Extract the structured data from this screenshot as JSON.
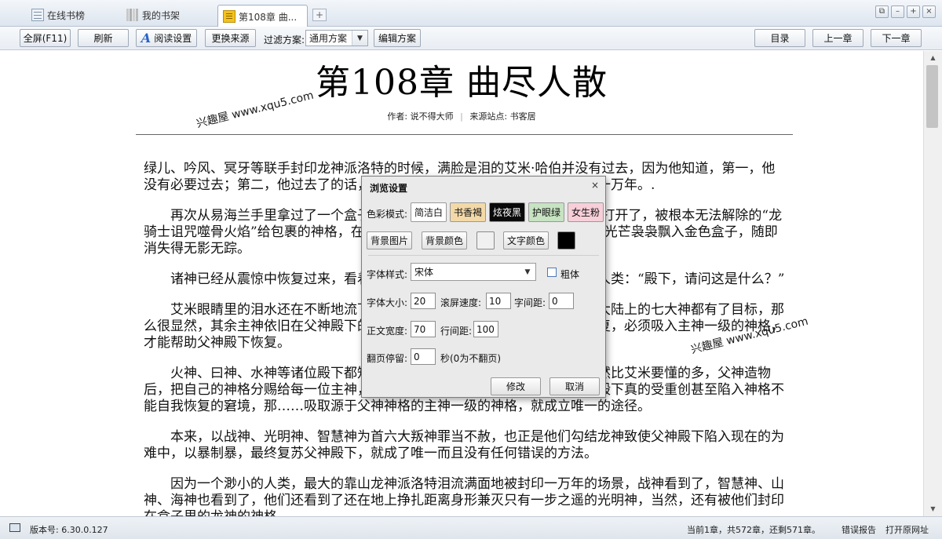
{
  "tabs": [
    {
      "label": "在线书榜",
      "icon": "list-icon"
    },
    {
      "label": "我的书架",
      "icon": "bookshelf-icon"
    },
    {
      "label": "第108章  曲...",
      "icon": "book-icon",
      "close": "×"
    }
  ],
  "tab_add": "+",
  "window_buttons": {
    "restore": "⧉",
    "minimize": "–",
    "maximize": "+",
    "close": "×"
  },
  "toolbar": {
    "fullscreen": "全屏(F11)",
    "refresh": "刷新",
    "reading_settings": "阅读设置",
    "change_source": "更换来源",
    "filter_label": "过滤方案:",
    "filter_value": "通用方案",
    "edit_filter": "编辑方案",
    "toc": "目录",
    "prev_chapter": "上一章",
    "next_chapter": "下一章"
  },
  "chapter": {
    "title": "第108章  曲尽人散",
    "author_label": "作者:",
    "author": "说不得大师",
    "source_label": "来源站点:",
    "source": "书客居"
  },
  "watermarks": {
    "w1": "兴趣屋 www.xqu5.com",
    "w2": "兴趣屋 www.xqu5.com"
  },
  "paragraphs": [
    "绿儿、吟风、冥牙等联手封印龙神派洛特的时候，满脸是泪的艾米·哈伯并没有过去，因为他知道，第一，他没有必要过去；第二，他过去了的话，派洛特肯定会在封印里的中行山会骂他一万年。.",
    "再次从易海兰手里拿过了一个盒子，艾米·哈伯打开盒子，在父神殿下身边打开了，被根本无法解除的“龙骑士诅咒噬骨火焰”给包裹的神格，在父神殿下的身边开始破碎，一缕乳白色的光芒袅袅飘入金色盒子，随即消失得无影无踪。",
    "诸神已经从震惊中恢复过来，看着这个刚刚在所有神祇面前露脸，渺小的人类：“殿下，请问这是什么？”",
    "艾米眼睛里的泪水还在不断地流下，只是声音异常平静，他说道：众诸斯大陆上的七大神都有了目标，那么很显然，其余主神依旧在父神殿下的诅咒之中，父神殿下受重伤，如果想恢复，必须吸入主神一级的神格，才能帮助父神殿下恢复。",
    "火神、曰神、水神等诸位殿下都知道，这些神祇都曾是父神所造，他们显然比艾米要懂的多，父神造物后，把自己的神格分赐给每一位主神，所以，按照神界古老的所讲，如果父神殿下真的受重创甚至陷入神格不能自我恢复的窘境，那……吸取源于父神神格的主神一级的神格，就成立唯一的途径。",
    "本来，以战神、光明神、智慧神为首六大叛神罪当不赦，也正是他们勾结龙神致使父神殿下陷入现在的为难中，以暴制暴，最终复苏父神殿下，就成了唯一而且没有任何错误的方法。",
    "因为一个渺小的人类，最大的靠山龙神派洛特泪流满面地被封印一万年的场景，战神看到了，智慧神、山神、海神也看到了，他们还看到了还在地上挣扎距离身形兼灭只有一步之遥的光明神，当然，还有被他们封印在盒子里的龙神的神格。"
  ],
  "dialog": {
    "title": "浏览设置",
    "close": "×",
    "color_mode_label": "色彩模式:",
    "modes": [
      {
        "label": "简洁白",
        "bg": "#ffffff",
        "fg": "#111111"
      },
      {
        "label": "书香褐",
        "bg": "#f3d9a8",
        "fg": "#111111"
      },
      {
        "label": "炫夜黑",
        "bg": "#0a0a0a",
        "fg": "#ffffff"
      },
      {
        "label": "护眼绿",
        "bg": "#c7e3c2",
        "fg": "#111111"
      },
      {
        "label": "女生粉",
        "bg": "#f7cfd9",
        "fg": "#111111"
      }
    ],
    "bg_image": "背景图片",
    "bg_color": "背景颜色",
    "bg_color_value": "#f0f0f0",
    "text_color": "文字颜色",
    "text_color_value": "#000000",
    "font_style_label": "字体样式:",
    "font_style_value": "宋体",
    "bold_label": "粗体",
    "font_size_label": "字体大小:",
    "font_size": "20",
    "scroll_speed_label": "滚屏速度:",
    "scroll_speed": "10",
    "char_spacing_label": "字间距:",
    "char_spacing": "0",
    "body_width_label": "正文宽度:",
    "body_width": "70",
    "line_spacing_label": "行间距:",
    "line_spacing": "100",
    "page_stay_label": "翻页停留:",
    "page_stay": "0",
    "page_stay_unit": "秒(0为不翻页)",
    "ok": "修改",
    "cancel": "取消"
  },
  "statusbar": {
    "version": "版本号: 6.30.0.127",
    "progress": "当前1章，共572章，还剩571章。",
    "report": "错误报告",
    "open_url": "打开原网址"
  }
}
